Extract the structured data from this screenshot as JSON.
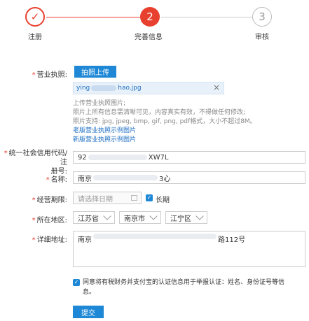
{
  "steps": [
    {
      "label": "注册",
      "number": "✓"
    },
    {
      "label": "完善信息",
      "number": "2"
    },
    {
      "label": "审核",
      "number": "3"
    }
  ],
  "colors": {
    "accent": "#e8402f",
    "primary": "#1e88d6"
  },
  "license": {
    "label": "营业执照:",
    "upload_button": "拍照上传",
    "file_prefix": "ying",
    "file_suffix": "hao.jpg",
    "hints": [
      "上传营业执照图片;",
      "照片上所有信息需清晰可见，内容真实有效，不得做任何修改;",
      "照片支持: jpg, jpeg, bmp, gif, png, pdf格式，大小不超过8M。"
    ],
    "old_example_link": "老版营业执照示例图片",
    "new_example_link": "新版营业执照示例图片"
  },
  "credit_code": {
    "label_line1": "统一社会信用代码/注",
    "label_line2": "册号:",
    "value_prefix": "92",
    "value_suffix": "XW7L"
  },
  "name": {
    "label": "名称:",
    "value_prefix": "南京",
    "value_suffix": "3心"
  },
  "business_term": {
    "label": "经营期限:",
    "placeholder": "请选择日期",
    "long_term_label": "长期"
  },
  "region": {
    "label": "所在地区:",
    "province": "江苏省",
    "city": "南京市",
    "district": "江宁区"
  },
  "address": {
    "label": "详细地址:",
    "value_prefix": "南京",
    "value_suffix": "路112号"
  },
  "agreement": {
    "text_line1": "同意将有税财务并支付宝的认证信息用于举报认证：姓名、身份证号等信",
    "text_line2": "息。"
  },
  "submit_label": "提交"
}
